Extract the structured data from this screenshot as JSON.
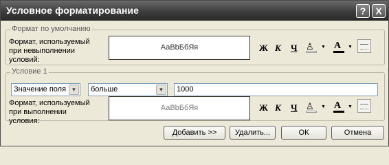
{
  "window": {
    "title": "Условное форматирование",
    "help_label": "?",
    "close_label": "X"
  },
  "default_format": {
    "group_label": "Формат по умолчанию",
    "description": "Формат, используемый при невыполнении условий:",
    "preview_text": "АаBbБбЯя"
  },
  "condition1": {
    "group_label": "Условие 1",
    "field_type": "Значение поля",
    "operator": "больше",
    "value": "1000",
    "description": "Формат, используемый при выполнении условия:",
    "preview_text": "АаBbБбЯя"
  },
  "format_toolbar": {
    "bold_label": "Ж",
    "italic_label": "К",
    "underline_label": "Ч",
    "fill_icon": "paint-bucket-icon",
    "font_color_label": "A",
    "border_icon": "border-icon",
    "dropdown_arrow": "▼"
  },
  "buttons": {
    "add": "Добавить >>",
    "delete": "Удалить...",
    "ok": "ОК",
    "cancel": "Отмена"
  },
  "colors": {
    "title_bar": "#3e3e3e",
    "dialog_bg": "#ece9d8"
  }
}
